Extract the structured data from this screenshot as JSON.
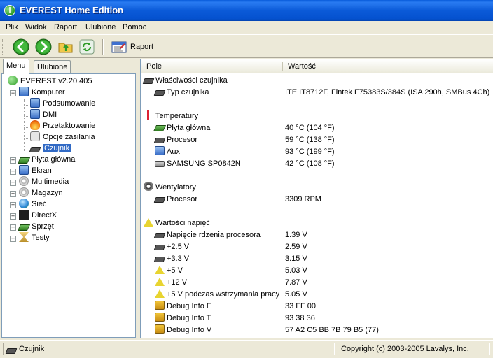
{
  "window": {
    "title": "EVEREST Home Edition",
    "app_icon_glyph": "i"
  },
  "menu": [
    "Plik",
    "Widok",
    "Raport",
    "Ulubione",
    "Pomoc"
  ],
  "toolbar": {
    "report_label": "Raport"
  },
  "tabs": {
    "menu": "Menu",
    "favorites": "Ulubione"
  },
  "tree": {
    "root": "EVEREST v2.20.405",
    "computer": "Komputer",
    "computer_children": [
      "Podsumowanie",
      "DMI",
      "Przetaktowanie",
      "Opcje zasilania",
      "Czujnik"
    ],
    "expand_minus": "−",
    "expand_plus": "+",
    "top_items": [
      "Płyta główna",
      "Ekran",
      "Multimedia",
      "Magazyn",
      "Sieć",
      "DirectX",
      "Sprzęt",
      "Testy"
    ]
  },
  "columns": {
    "field": "Pole",
    "value": "Wartość"
  },
  "sections": {
    "sensor_props": {
      "title": "Właściwości czujnika",
      "rows": [
        {
          "label": "Typ czujnika",
          "value": "ITE IT8712F, Fintek F75383S/384S  (ISA 290h, SMBus 4Ch)"
        }
      ]
    },
    "temperatures": {
      "title": "Temperatury",
      "rows": [
        {
          "label": "Płyta główna",
          "value": "40 °C  (104 °F)"
        },
        {
          "label": "Procesor",
          "value": "59 °C  (138 °F)"
        },
        {
          "label": "Aux",
          "value": "93 °C  (199 °F)"
        },
        {
          "label": "SAMSUNG SP0842N",
          "value": "42 °C  (108 °F)"
        }
      ]
    },
    "fans": {
      "title": "Wentylatory",
      "rows": [
        {
          "label": "Procesor",
          "value": "3309 RPM"
        }
      ]
    },
    "voltages": {
      "title": "Wartości napięć",
      "rows": [
        {
          "label": "Napięcie rdzenia procesora",
          "value": "1.39 V"
        },
        {
          "label": "+2.5 V",
          "value": "2.59 V"
        },
        {
          "label": "+3.3 V",
          "value": "3.15 V"
        },
        {
          "label": "+5 V",
          "value": "5.03 V"
        },
        {
          "label": "+12 V",
          "value": "7.87 V"
        },
        {
          "label": "+5 V podczas wstrzymania pracy",
          "value": "5.05 V"
        },
        {
          "label": "Debug Info F",
          "value": "33 FF 00"
        },
        {
          "label": "Debug Info T",
          "value": "93 38 36"
        },
        {
          "label": "Debug Info V",
          "value": "57 A2 C5 BB 7B 79 B5 (77)"
        }
      ]
    }
  },
  "status": {
    "left": "Czujnik",
    "right": "Copyright (c) 2003-2005 Lavalys, Inc."
  }
}
